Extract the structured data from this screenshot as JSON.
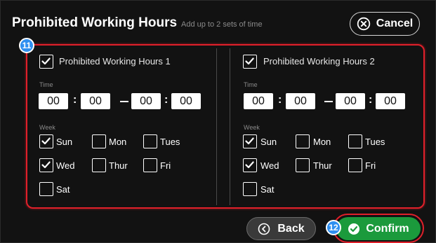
{
  "header": {
    "title": "Prohibited Working Hours",
    "subtitle": "Add up to 2 sets of time",
    "cancel_label": "Cancel"
  },
  "badges": {
    "settings": "11",
    "confirm": "12"
  },
  "panels": [
    {
      "enabled": true,
      "heading": "Prohibited Working Hours 1",
      "time_label": "Time",
      "start_hour": "00",
      "start_minute": "00",
      "end_hour": "00",
      "end_minute": "00",
      "week_label": "Week",
      "days": [
        {
          "label": "Sun",
          "checked": true
        },
        {
          "label": "Mon",
          "checked": false
        },
        {
          "label": "Tues",
          "checked": false
        },
        {
          "label": "Wed",
          "checked": true
        },
        {
          "label": "Thur",
          "checked": false
        },
        {
          "label": "Fri",
          "checked": false
        },
        {
          "label": "Sat",
          "checked": false
        }
      ]
    },
    {
      "enabled": true,
      "heading": "Prohibited Working Hours 2",
      "time_label": "Time",
      "start_hour": "00",
      "start_minute": "00",
      "end_hour": "00",
      "end_minute": "00",
      "week_label": "Week",
      "days": [
        {
          "label": "Sun",
          "checked": true
        },
        {
          "label": "Mon",
          "checked": false
        },
        {
          "label": "Tues",
          "checked": false
        },
        {
          "label": "Wed",
          "checked": true
        },
        {
          "label": "Thur",
          "checked": false
        },
        {
          "label": "Fri",
          "checked": false
        },
        {
          "label": "Sat",
          "checked": false
        }
      ]
    }
  ],
  "footer": {
    "back_label": "Back",
    "confirm_label": "Confirm"
  },
  "colors": {
    "background": "#121212",
    "highlight": "#e0202a",
    "badge": "#2f8ff0",
    "confirm": "#1b9a3c",
    "back": "#3a3a3a"
  },
  "icons": {
    "cancel": "circle-x-icon",
    "back": "circle-chevron-left-icon",
    "confirm": "circle-check-icon",
    "checkbox_checked": "check-icon"
  }
}
